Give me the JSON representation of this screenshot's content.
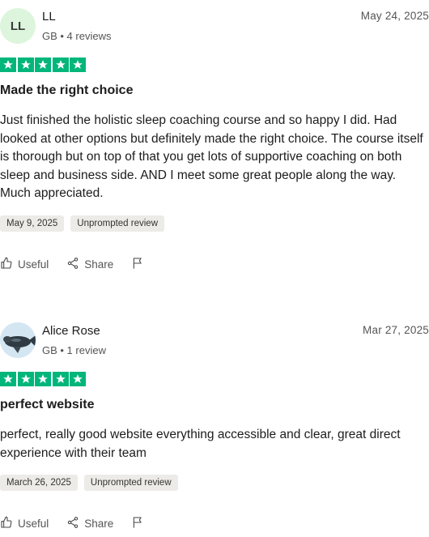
{
  "reviews": [
    {
      "avatar_initials": "LL",
      "name": "LL",
      "meta": "GB • 4 reviews",
      "date": "May 24, 2025",
      "rating": 5,
      "title": "Made the right choice",
      "body": "Just finished the holistic sleep coaching course and so happy I did. Had looked at other options but definitely made the right choice. The course itself is thorough but on top of that you get lots of supportive coaching on both sleep and business side. AND I meet some great people along the way. Much appreciated.",
      "experience_date": "May 9, 2025",
      "label": "Unprompted review",
      "useful_label": "Useful",
      "share_label": "Share"
    },
    {
      "name": "Alice Rose",
      "meta": "GB • 1 review",
      "date": "Mar 27, 2025",
      "rating": 5,
      "title": "perfect website",
      "body": "perfect, really good website everything accessible and clear, great direct experience with their team",
      "experience_date": "March 26, 2025",
      "label": "Unprompted review",
      "useful_label": "Useful",
      "share_label": "Share"
    }
  ],
  "colors": {
    "star_green": "#00b67a",
    "avatar_green": "#dcf5dc",
    "tag_bg": "#ecebe7"
  }
}
